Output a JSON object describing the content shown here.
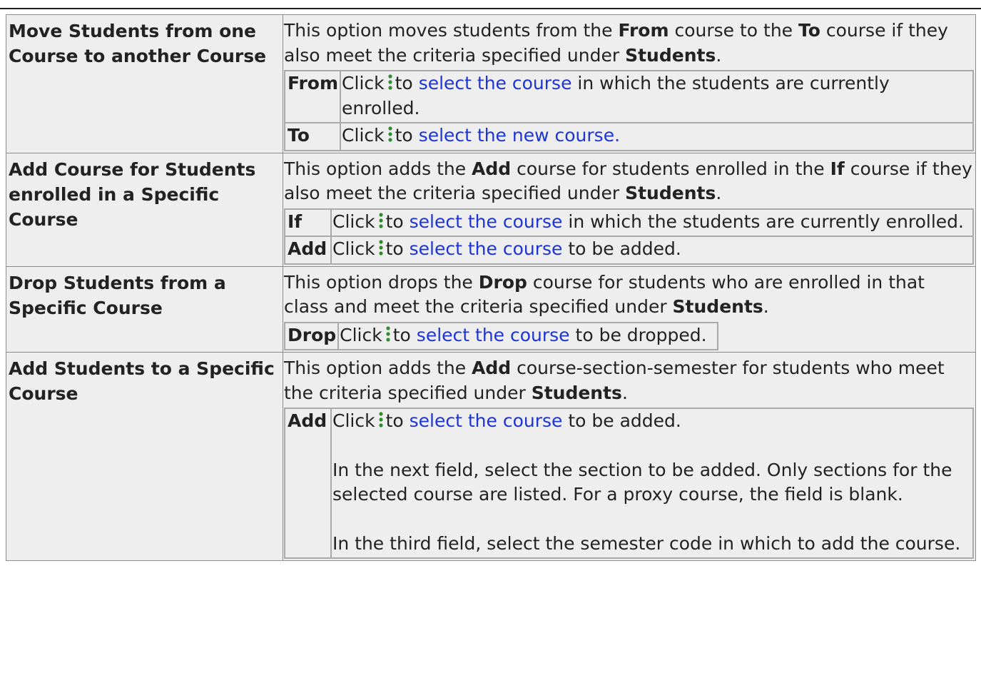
{
  "rows": [
    {
      "label": "Move Students from one Course to another Course",
      "desc_parts": [
        {
          "text": "This option moves students from the ",
          "bold": false
        },
        {
          "text": "From",
          "bold": true
        },
        {
          "text": " course to the ",
          "bold": false
        },
        {
          "text": "To",
          "bold": true
        },
        {
          "text": " course if they also meet the criteria specified under ",
          "bold": false
        },
        {
          "text": "Students",
          "bold": true
        },
        {
          "text": ".",
          "bold": false
        }
      ],
      "fields": [
        {
          "name": "From",
          "click": "Click",
          "to": "to",
          "link": "select the course",
          "rest": "in which the students are currently enrolled."
        },
        {
          "name": "To",
          "click": "Click",
          "to": "to",
          "link": "select the new course.",
          "rest": ""
        }
      ]
    },
    {
      "label": "Add Course for Students enrolled in a Specific Course",
      "desc_parts": [
        {
          "text": "This option adds the ",
          "bold": false
        },
        {
          "text": "Add",
          "bold": true
        },
        {
          "text": " course for students enrolled in the ",
          "bold": false
        },
        {
          "text": "If",
          "bold": true
        },
        {
          "text": " course if they also meet the criteria specified under ",
          "bold": false
        },
        {
          "text": "Students",
          "bold": true
        },
        {
          "text": ".",
          "bold": false
        }
      ],
      "fields": [
        {
          "name": "If",
          "click": "Click",
          "to": "to",
          "link": "select the course",
          "rest": "in which the students are currently enrolled."
        },
        {
          "name": "Add",
          "click": "Click",
          "to": "to",
          "link": "select the course",
          "rest": "to be added."
        }
      ]
    },
    {
      "label": "Drop Students from a Specific Course",
      "desc_parts": [
        {
          "text": "This option drops the ",
          "bold": false
        },
        {
          "text": "Drop",
          "bold": true
        },
        {
          "text": " course for students who are enrolled in that class and meet the criteria specified under ",
          "bold": false
        },
        {
          "text": "Students",
          "bold": true
        },
        {
          "text": ".",
          "bold": false
        }
      ],
      "fields": [
        {
          "name": "Drop",
          "click": "Click",
          "to": "to",
          "link": "select the course",
          "rest": "to be dropped."
        }
      ]
    },
    {
      "label": "Add Students to a Specific Course",
      "desc_parts": [
        {
          "text": "This option adds the ",
          "bold": false
        },
        {
          "text": "Add",
          "bold": true
        },
        {
          "text": " course-section-semester for students who meet the criteria specified under ",
          "bold": false
        },
        {
          "text": "Students",
          "bold": true
        },
        {
          "text": ".",
          "bold": false
        }
      ],
      "fields": [
        {
          "name": "Add",
          "click": "Click",
          "to": "to",
          "link": "select the course",
          "rest": "to be added.",
          "extra": [
            "In the next field, select the section to be added. Only sections for the selected course are listed. For a proxy course, the field is blank.",
            "In the third field, select the semester code in which to add the course."
          ]
        }
      ]
    }
  ],
  "icons": {
    "select": "vertical-dots-icon"
  },
  "colors": {
    "link": "#1d34d6",
    "icon": "#2e8b2e",
    "cell_bg": "#eeeeee"
  }
}
